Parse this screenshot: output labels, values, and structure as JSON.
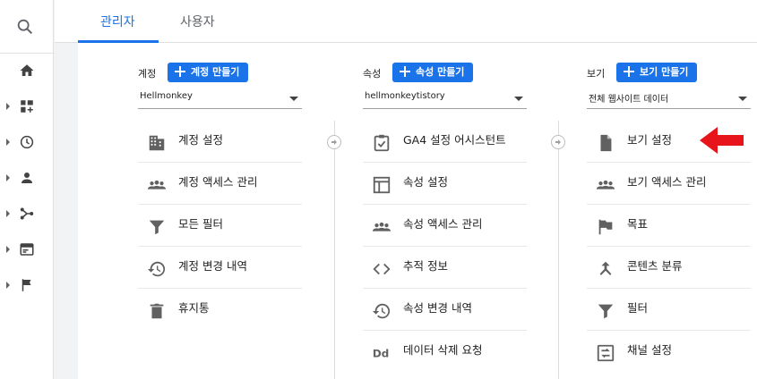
{
  "sidebar": {
    "icons": [
      "search-icon",
      "home-icon",
      "dashboard-add-icon",
      "clock-icon",
      "person-icon",
      "share-icon",
      "display-icon",
      "flag-icon"
    ]
  },
  "tabs": [
    {
      "label": "관리자",
      "active": true
    },
    {
      "label": "사용자",
      "active": false
    }
  ],
  "columns": [
    {
      "head_label": "계정",
      "button_label": "계정 만들기",
      "select_value": "Hellmonkey",
      "items": [
        {
          "label": "계정 설정",
          "icon": "building-icon"
        },
        {
          "label": "계정 액세스 관리",
          "icon": "people-icon"
        },
        {
          "label": "모든 필터",
          "icon": "filter-icon"
        },
        {
          "label": "계정 변경 내역",
          "icon": "history-icon"
        },
        {
          "label": "휴지통",
          "icon": "trash-icon"
        }
      ]
    },
    {
      "head_label": "속성",
      "button_label": "속성 만들기",
      "select_value": "hellmonkeytistory",
      "items": [
        {
          "label": "GA4 설정 어시스턴트",
          "icon": "checklist-icon"
        },
        {
          "label": "속성 설정",
          "icon": "layout-icon"
        },
        {
          "label": "속성 액세스 관리",
          "icon": "people-icon"
        },
        {
          "label": "추적 정보",
          "icon": "code-icon"
        },
        {
          "label": "속성 변경 내역",
          "icon": "history-icon"
        },
        {
          "label": "데이터 삭제 요청",
          "icon": "dd-icon"
        }
      ]
    },
    {
      "head_label": "보기",
      "button_label": "보기 만들기",
      "select_value": "전체 웹사이트 데이터",
      "items": [
        {
          "label": "보기 설정",
          "icon": "file-icon"
        },
        {
          "label": "보기 액세스 관리",
          "icon": "people-icon"
        },
        {
          "label": "목표",
          "icon": "flag-icon"
        },
        {
          "label": "콘텐츠 분류",
          "icon": "merge-icon"
        },
        {
          "label": "필터",
          "icon": "filter-icon"
        },
        {
          "label": "채널 설정",
          "icon": "channel-icon"
        }
      ]
    }
  ],
  "colors": {
    "accent": "#1a73e8",
    "annotation": "#e8141b"
  }
}
